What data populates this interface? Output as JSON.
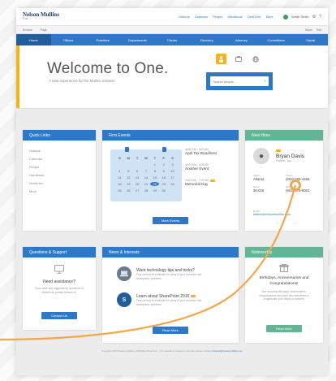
{
  "brand": {
    "name": "Nelson Mullins",
    "tagline": "One"
  },
  "top_links": [
    "Outlook",
    "Calendar",
    "People",
    "Handbook",
    "OneDrive",
    "More"
  ],
  "user": {
    "name": "Sarah Smith"
  },
  "breadcrumbs": [
    "Browse",
    "Page"
  ],
  "breadbar_right": [
    "Share",
    "Edit"
  ],
  "nav": [
    "Home",
    "Offices",
    "Practices",
    "Departments",
    "Clients",
    "Directory",
    "Attorney",
    "Committees",
    "Social"
  ],
  "hero": {
    "title": "Welcome to One.",
    "subtitle": "A new experience for the Mullins intranet",
    "search_placeholder": "Search people..."
  },
  "quick_links": {
    "title": "Quick Links",
    "items": [
      "Outlook",
      "Calendar",
      "People",
      "Handbook",
      "OneDrive",
      "More"
    ]
  },
  "firm_events": {
    "title": "Firm Events",
    "calendar_headers": [
      "S",
      "M",
      "T",
      "W",
      "T",
      "F",
      "S"
    ],
    "calendar_days": [
      "",
      "",
      "",
      "",
      "1",
      "2",
      "3",
      "4",
      "5",
      "6",
      "7",
      "8",
      "9",
      "10",
      "11",
      "12",
      "13",
      "14",
      "15",
      "16",
      "17",
      "18",
      "19",
      "20",
      "21",
      "22",
      "23",
      "24",
      "25",
      "26",
      "27",
      "28",
      "29",
      "30",
      "",
      ""
    ],
    "today": "22",
    "events": [
      {
        "date": "4/15/2016 · 8:00 AM",
        "title": "April Tax Deadlines",
        "badge": false
      },
      {
        "date": "4/22/2016 · 8:00 AM",
        "title": "Another Event",
        "badge": false
      },
      {
        "date": "5/30/2016 · 7:00 AM",
        "title": "Memorial Day",
        "badge": true
      }
    ],
    "button": "More Events"
  },
  "new_hires": {
    "title": "New Hires",
    "name": "Bryan Davis",
    "role": "Partner, Tax",
    "fields": [
      {
        "label": "Office",
        "value": "Atlanta"
      },
      {
        "label": "Phone",
        "value": "(803) 555-4455"
      },
      {
        "label": "Room",
        "value": "30.026"
      },
      {
        "label": "Mobile",
        "value": "(803) 378-9001"
      }
    ],
    "email_label": "Email",
    "email": "bdavis@nelsonmullins.com",
    "prev_arrow": "←",
    "next_arrow": "→"
  },
  "questions": {
    "title": "Questions & Support",
    "heading": "Need assistance?",
    "text": "If you have any suggestions, questions or comments, please contact us.",
    "button": "Contact Us"
  },
  "news": {
    "title": "News & Interests",
    "items": [
      {
        "title": "Want technology tips and tricks?",
        "desc": "Find out how to eliminate the pains of your computer and smartphone problems."
      },
      {
        "title": "Learn about SharePoint 2016",
        "desc": "Find out how to eliminate the pains of your computer and smartphone problems."
      }
    ],
    "button": "Read More"
  },
  "announcements": {
    "title": "Noteworthy",
    "heading": "Birthdays, Anniversaries and Congratulations!",
    "text": "See complete birthdays, anniversaries, congratulations and other firm-wide items to congratulate your fellow co-workers.",
    "button": "Read More"
  },
  "footer": {
    "text": "Copyright 2016 Nelson Mullins. All Rights Reserved. · For questions related to this site, please contact ",
    "email": "intranet@nelsonmullins.com"
  },
  "colors": {
    "primary": "#2d79c7",
    "accent": "#f5b21b",
    "green": "#63b596",
    "swoosh": "#f3a64a"
  }
}
